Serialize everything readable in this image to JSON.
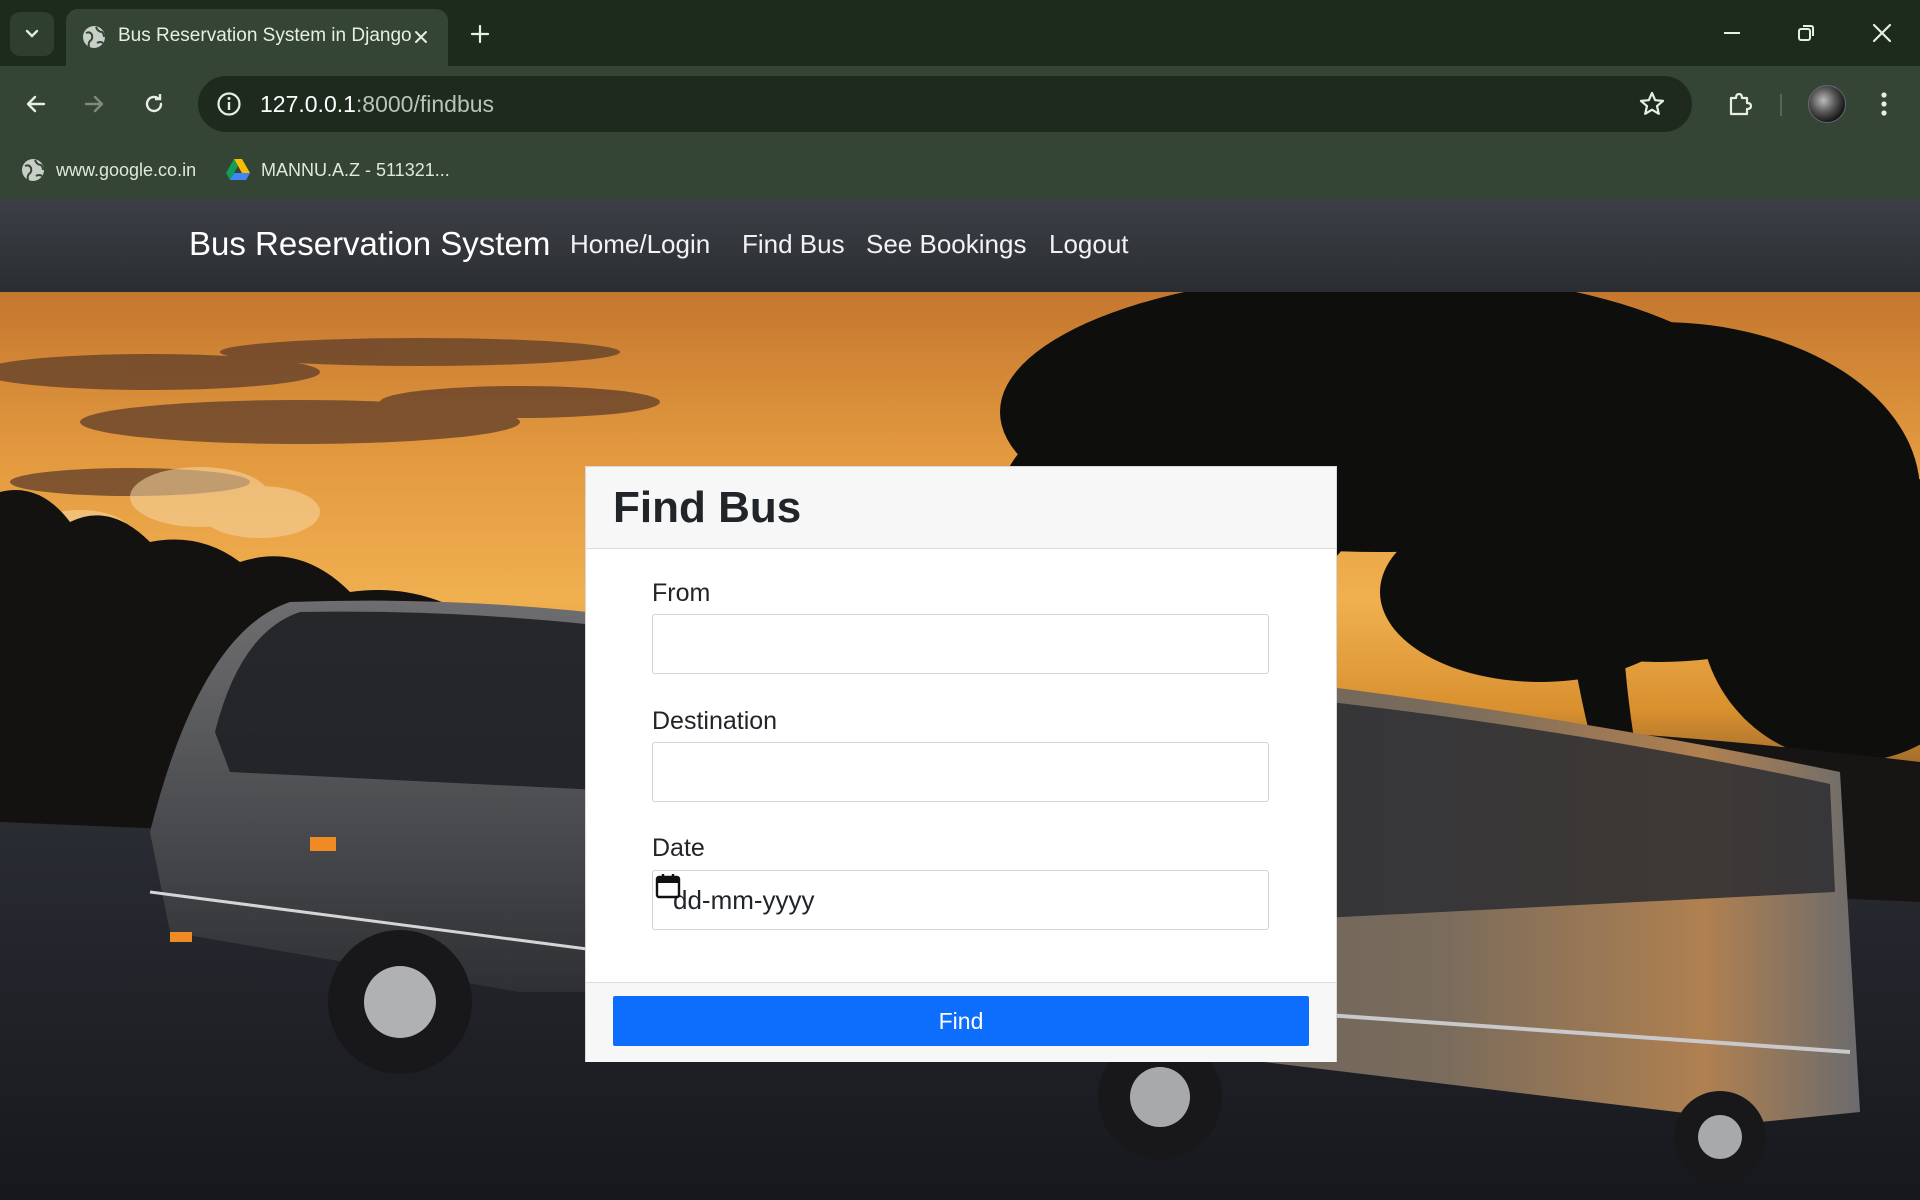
{
  "browser": {
    "tab_title": "Bus Reservation System in Django",
    "url_host": "127.0.0.1",
    "url_path": ":8000/findbus",
    "bookmarks": [
      {
        "label": "www.google.co.in",
        "icon": "globe-icon"
      },
      {
        "label": "MANNU.A.Z - 511321...",
        "icon": "google-drive-icon"
      }
    ]
  },
  "site": {
    "brand": "Bus Reservation System",
    "nav": [
      "Home/Login",
      "Find Bus",
      "See Bookings",
      "Logout"
    ]
  },
  "form": {
    "title": "Find Bus",
    "fields": [
      {
        "label": "From",
        "value": ""
      },
      {
        "label": "Destination",
        "value": ""
      },
      {
        "label": "Date",
        "value": "dd-mm-yyyy"
      }
    ],
    "submit_label": "Find"
  },
  "colors": {
    "primary_button": "#0d6efd",
    "navbar": "#2f3236",
    "browser_frame": "#354535"
  },
  "hero_image": "coach buses at sunset with tree silhouettes"
}
